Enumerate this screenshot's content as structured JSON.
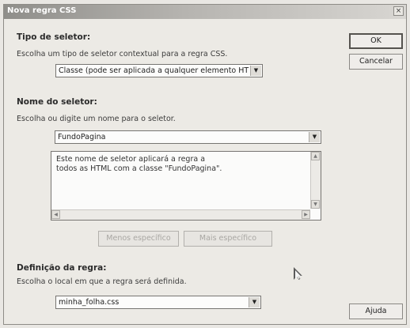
{
  "window": {
    "title": "Nova regra CSS",
    "close_icon": "×"
  },
  "selector_type": {
    "heading": "Tipo de seletor:",
    "description": "Escolha um tipo de seletor contextual para a regra CSS.",
    "selected": "Classe (pode ser aplicada a qualquer elemento HTML)"
  },
  "selector_name": {
    "heading": "Nome do seletor:",
    "description": "Escolha ou digite um nome para o seletor.",
    "value": "FundoPagina",
    "info_line1": "Este nome de seletor aplicará a regra a",
    "info_line2": "todos as HTML com a classe \"FundoPagina\".",
    "less_specific": "Menos específico",
    "more_specific": "Mais específico"
  },
  "rule_definition": {
    "heading": "Definição da regra:",
    "description": "Escolha o local em que a regra será definida.",
    "selected": "minha_folha.css"
  },
  "buttons": {
    "ok": "OK",
    "cancel": "Cancelar",
    "help": "Ajuda"
  },
  "icons": {
    "dropdown": "▼",
    "scroll_up": "▲",
    "scroll_down": "▼",
    "scroll_left": "◀",
    "scroll_right": "▶"
  }
}
